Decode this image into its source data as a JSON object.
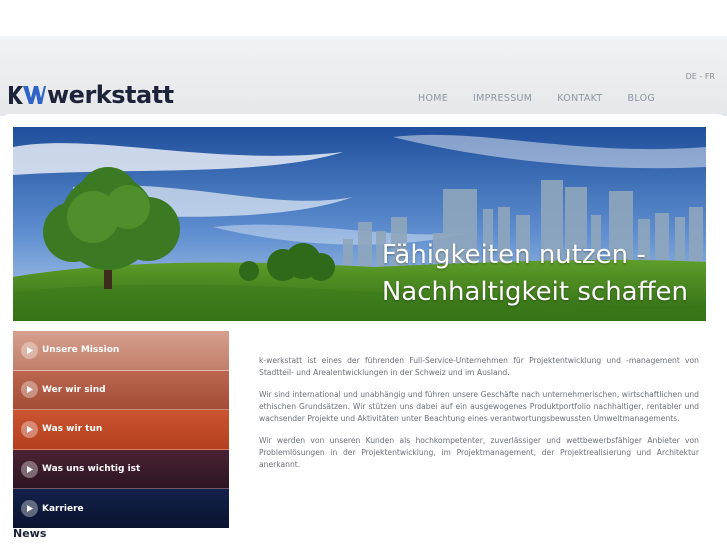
{
  "logo": {
    "text": "werkstatt"
  },
  "lang": {
    "de": "DE",
    "sep": " - ",
    "fr": "FR"
  },
  "nav": [
    {
      "label": "HOME"
    },
    {
      "label": "IMPRESSUM"
    },
    {
      "label": "KONTAKT"
    },
    {
      "label": "BLOG"
    }
  ],
  "banner": {
    "line1": "Fähigkeiten nutzen -",
    "line2": "Nachhaltigkeit schaffen"
  },
  "menu": [
    {
      "label": "Unsere Mission",
      "color": "#c78b78"
    },
    {
      "label": "Wer wir sind",
      "color": "#b05a43"
    },
    {
      "label": "Was wir tun",
      "color": "#c14a2c"
    },
    {
      "label": "Was uns wichtig ist",
      "color": "#3b1c2c"
    },
    {
      "label": "Karriere",
      "color": "#0f1a3a"
    }
  ],
  "news": {
    "title": "News"
  },
  "intro": {
    "p1": "k-werkstatt ist eines der führenden Full-Service-Unternehmen für Projektentwicklung und -management von Stadtteil- und Arealentwicklungen in der Schweiz und im Ausland.",
    "p2": "Wir sind international und unabhängig und führen unsere Geschäfte nach unternehmerischen, wirtschaftlichen und ethischen Grundsätzen. Wir stützen uns dabei auf ein ausgewogenes Produktportfolio nachhaltiger, rentabler und wachsender Projekte und Aktivitäten unter Beachtung eines verantwortungsbewussten Umweltmanagements.",
    "p3": "Wir werden von unseren Kunden als hochkompetenter, zuverlässiger und wettbewerbsfähiger Anbieter von Problemlösungen in der Projektentwicklung, im Projektmanagement, der Projektrealisierung und Architektur anerkannt."
  }
}
